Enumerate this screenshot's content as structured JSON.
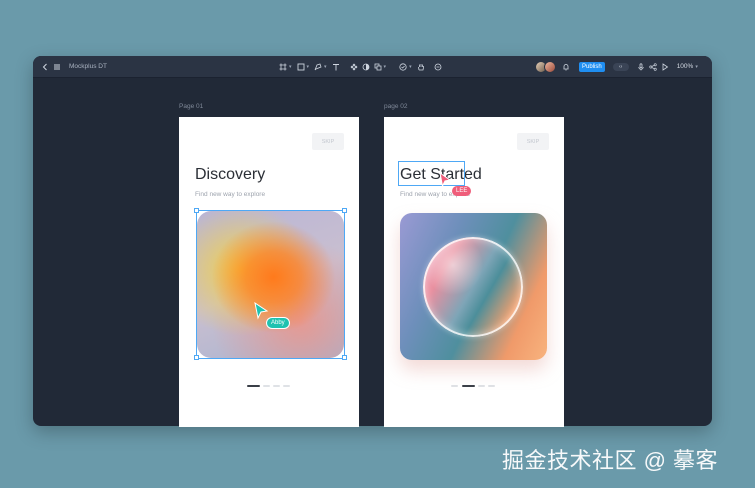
{
  "app": {
    "title": "Mockplus DT",
    "publish_label": "Publish",
    "zoom": "100%",
    "toggle_icon": "code-icon"
  },
  "toolbar_icons": [
    "back-icon",
    "menu-icon",
    "artboard-icon",
    "rect-icon",
    "pen-icon",
    "text-icon",
    "component-icon",
    "contrast-icon",
    "layers-icon",
    "check-icon",
    "hand-icon",
    "comment-icon",
    "bell-icon",
    "mic-icon",
    "share-icon",
    "play-icon"
  ],
  "pages": [
    {
      "label": "Page 01",
      "skip": "SKIP",
      "heading": "Discovery",
      "subtitle": "Find new way to explore"
    },
    {
      "label": "page 02",
      "skip": "SKIP",
      "heading": "Get Started",
      "subtitle": "Find new way to explore"
    }
  ],
  "cursors": [
    {
      "name": "Abby",
      "color": "#1fc2b0"
    },
    {
      "name": "LEE",
      "color": "#ef5d7a"
    }
  ],
  "watermark": "掘金技术社区 @ 摹客",
  "colors": {
    "canvas": "#212937",
    "toolbar": "#2b3444",
    "background": "#6a9aaa",
    "selection": "#4ea8f5",
    "accent": "#1f8ef1"
  }
}
